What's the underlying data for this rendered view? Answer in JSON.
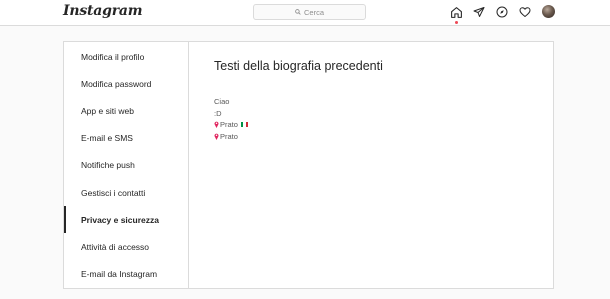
{
  "header": {
    "logo_text": "Instagram",
    "search": {
      "placeholder": "Cerca",
      "icon": "search-icon"
    },
    "nav_icons": [
      "home-icon",
      "direct-message-icon",
      "explore-icon",
      "activity-heart-icon",
      "profile-avatar"
    ],
    "notification_dot_color": "#ed4956"
  },
  "sidebar": {
    "items": [
      {
        "label": "Modifica il profilo",
        "active": false
      },
      {
        "label": "Modifica password",
        "active": false
      },
      {
        "label": "App e siti web",
        "active": false
      },
      {
        "label": "E-mail e SMS",
        "active": false
      },
      {
        "label": "Notifiche push",
        "active": false
      },
      {
        "label": "Gestisci i contatti",
        "active": false
      },
      {
        "label": "Privacy e sicurezza",
        "active": true
      },
      {
        "label": "Attività di accesso",
        "active": false
      },
      {
        "label": "E-mail da Instagram",
        "active": false
      }
    ]
  },
  "main": {
    "title": "Testi della biografia precedenti",
    "entries": [
      {
        "text": "Ciao"
      },
      {
        "text": ":D"
      },
      {
        "text": "Prato",
        "pin_icon": true,
        "flag_icon": "italy-flag-icon"
      },
      {
        "text": "Prato",
        "pin_icon": true
      }
    ]
  },
  "colors": {
    "pin": "#e0245e",
    "flag_green": "#009246",
    "flag_white": "#ffffff",
    "flag_red": "#ce2b37"
  }
}
